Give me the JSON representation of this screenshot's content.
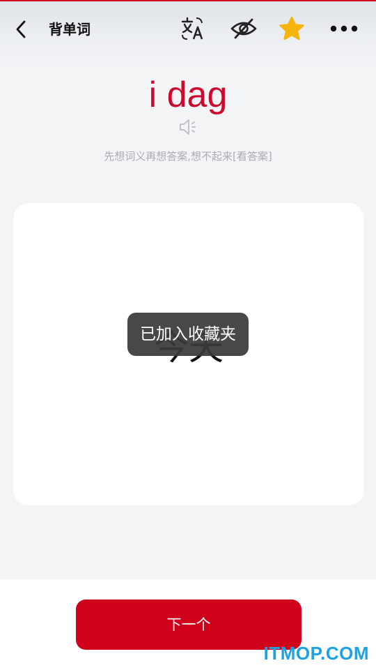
{
  "header": {
    "title": "背单词",
    "icons": {
      "back": "chevron-left-icon",
      "translate": "translate-icon",
      "hide": "eye-off-icon",
      "favorite": "star-icon",
      "more": "more-dots-icon"
    }
  },
  "word": {
    "text": "i dag",
    "hint": "先想词义再想答案,想不起来[看答案]",
    "audio_icon": "speaker-icon"
  },
  "card": {
    "meaning": "今天"
  },
  "toast": {
    "message": "已加入收藏夹"
  },
  "footer": {
    "next_label": "下一个"
  },
  "watermark": "ITMOP.COM",
  "colors": {
    "accent": "#d0021b",
    "word": "#cc0a2d",
    "star": "#f6b40e",
    "watermark": "#1ea1e3"
  }
}
